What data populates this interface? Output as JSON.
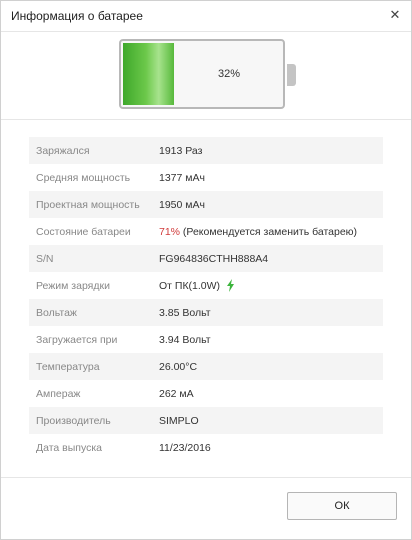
{
  "window": {
    "title": "Информация о батарее",
    "close_glyph": "✕"
  },
  "battery": {
    "percent_text": "32%",
    "level": 0.32
  },
  "info": [
    {
      "label": "Заряжался",
      "value": "1913 Раз"
    },
    {
      "label": "Средняя мощность",
      "value": "1377 мАч"
    },
    {
      "label": "Проектная мощность",
      "value": "1950 мАч"
    },
    {
      "label": "Состояние батареи",
      "value_highlight": "71%",
      "value_rest": " (Рекомендуется заменить батарею)"
    },
    {
      "label": "S/N",
      "value": "FG964836CTHH888A4"
    },
    {
      "label": "Режим зарядки",
      "value": "От ПК(1.0W)",
      "icon": "lightning-bolt-icon"
    },
    {
      "label": "Вольтаж",
      "value": "3.85 Вольт"
    },
    {
      "label": "Загружается при",
      "value": "3.94 Вольт"
    },
    {
      "label": "Температура",
      "value": "26.00°C"
    },
    {
      "label": "Ампераж",
      "value": "262 мА"
    },
    {
      "label": "Производитель",
      "value": "SIMPLO"
    },
    {
      "label": "Дата выпуска",
      "value": "11/23/2016"
    }
  ],
  "footer": {
    "ok_label": "ОК"
  },
  "colors": {
    "battery_green": "#5cbf3f",
    "warning_red": "#d13b3b",
    "bolt_green": "#3cb43c"
  }
}
